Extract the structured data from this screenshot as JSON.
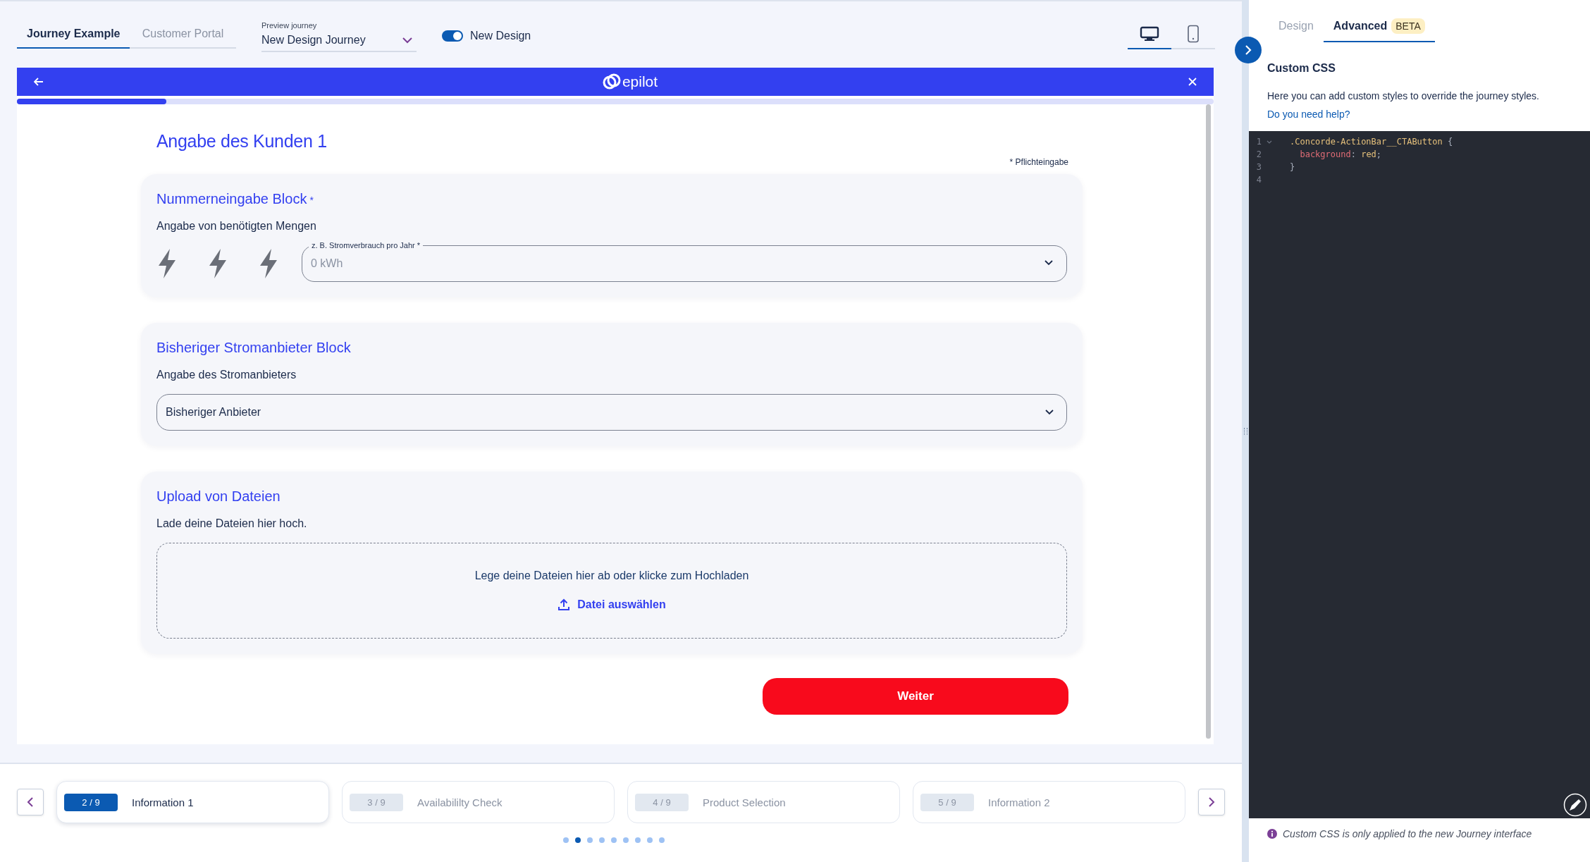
{
  "top_bar": {
    "tabs": [
      {
        "label": "Journey Example",
        "selected": true
      },
      {
        "label": "Customer Portal",
        "selected": false
      }
    ],
    "preview": {
      "label": "Preview journey",
      "value": "New Design Journey"
    },
    "toggle": {
      "label": "New Design",
      "on": true
    },
    "devices": [
      {
        "kind": "desktop",
        "selected": true
      },
      {
        "kind": "mobile",
        "selected": false
      }
    ]
  },
  "journey": {
    "logo": "epilot",
    "progress": {
      "level": 0.125
    },
    "heading": "Angabe des Kunden 1",
    "required_note": "* Pflichteingabe",
    "blocks": [
      {
        "kind": "number",
        "title": "Nummerneingabe Block",
        "required_mark": "*",
        "subtitle": "Angabe von benötigten Mengen",
        "field": {
          "label": "z. B. Stromverbrauch pro Jahr *",
          "placeholder": "0 kWh"
        }
      },
      {
        "kind": "select",
        "title": "Bisheriger Stromanbieter Block",
        "subtitle": "Angabe des Stromanbieters",
        "value": "Bisheriger Anbieter"
      },
      {
        "kind": "upload",
        "title": "Upload von Dateien",
        "subtitle": "Lade deine Dateien hier hoch.",
        "drop_text": "Lege deine Dateien hier ab oder klicke zum Hochladen",
        "button": "Datei auswählen"
      }
    ],
    "submit": "Weiter"
  },
  "stepper": {
    "steps": [
      {
        "badge": "2 / 9",
        "label": "Information 1",
        "selected": true
      },
      {
        "badge": "3 / 9",
        "label": "Availabililty Check",
        "selected": false
      },
      {
        "badge": "4 / 9",
        "label": "Product Selection",
        "selected": false
      },
      {
        "badge": "5 / 9",
        "label": "Information 2",
        "selected": false
      }
    ],
    "dots": [
      {
        "selected": false
      },
      {
        "selected": true
      },
      {
        "selected": false
      },
      {
        "selected": false
      },
      {
        "selected": false
      },
      {
        "selected": false
      },
      {
        "selected": false
      },
      {
        "selected": false
      },
      {
        "selected": false
      }
    ]
  },
  "panel": {
    "tabs": [
      {
        "label": "Design",
        "selected": false
      },
      {
        "label": "Advanced",
        "badge": "BETA",
        "selected": true
      }
    ],
    "title": "Custom CSS",
    "description": "Here you can add custom styles to override the journey styles.",
    "help_link": "Do you need help?",
    "code": [
      {
        "number": "1",
        "foldable": true,
        "tokens": [
          {
            "text": ".Concorde-ActionBar__CTAButton",
            "kind": "selector"
          },
          {
            "text": " {",
            "kind": "punct"
          }
        ]
      },
      {
        "number": "2",
        "foldable": false,
        "tokens": [
          {
            "text": "  background",
            "kind": "property"
          },
          {
            "text": ": ",
            "kind": "punct"
          },
          {
            "text": "red",
            "kind": "value"
          },
          {
            "text": ";",
            "kind": "punct"
          }
        ]
      },
      {
        "number": "3",
        "foldable": false,
        "tokens": [
          {
            "text": "}",
            "kind": "punct"
          }
        ]
      },
      {
        "number": "4",
        "foldable": false
      }
    ],
    "note": "Custom CSS is only applied to the new Journey interface"
  }
}
